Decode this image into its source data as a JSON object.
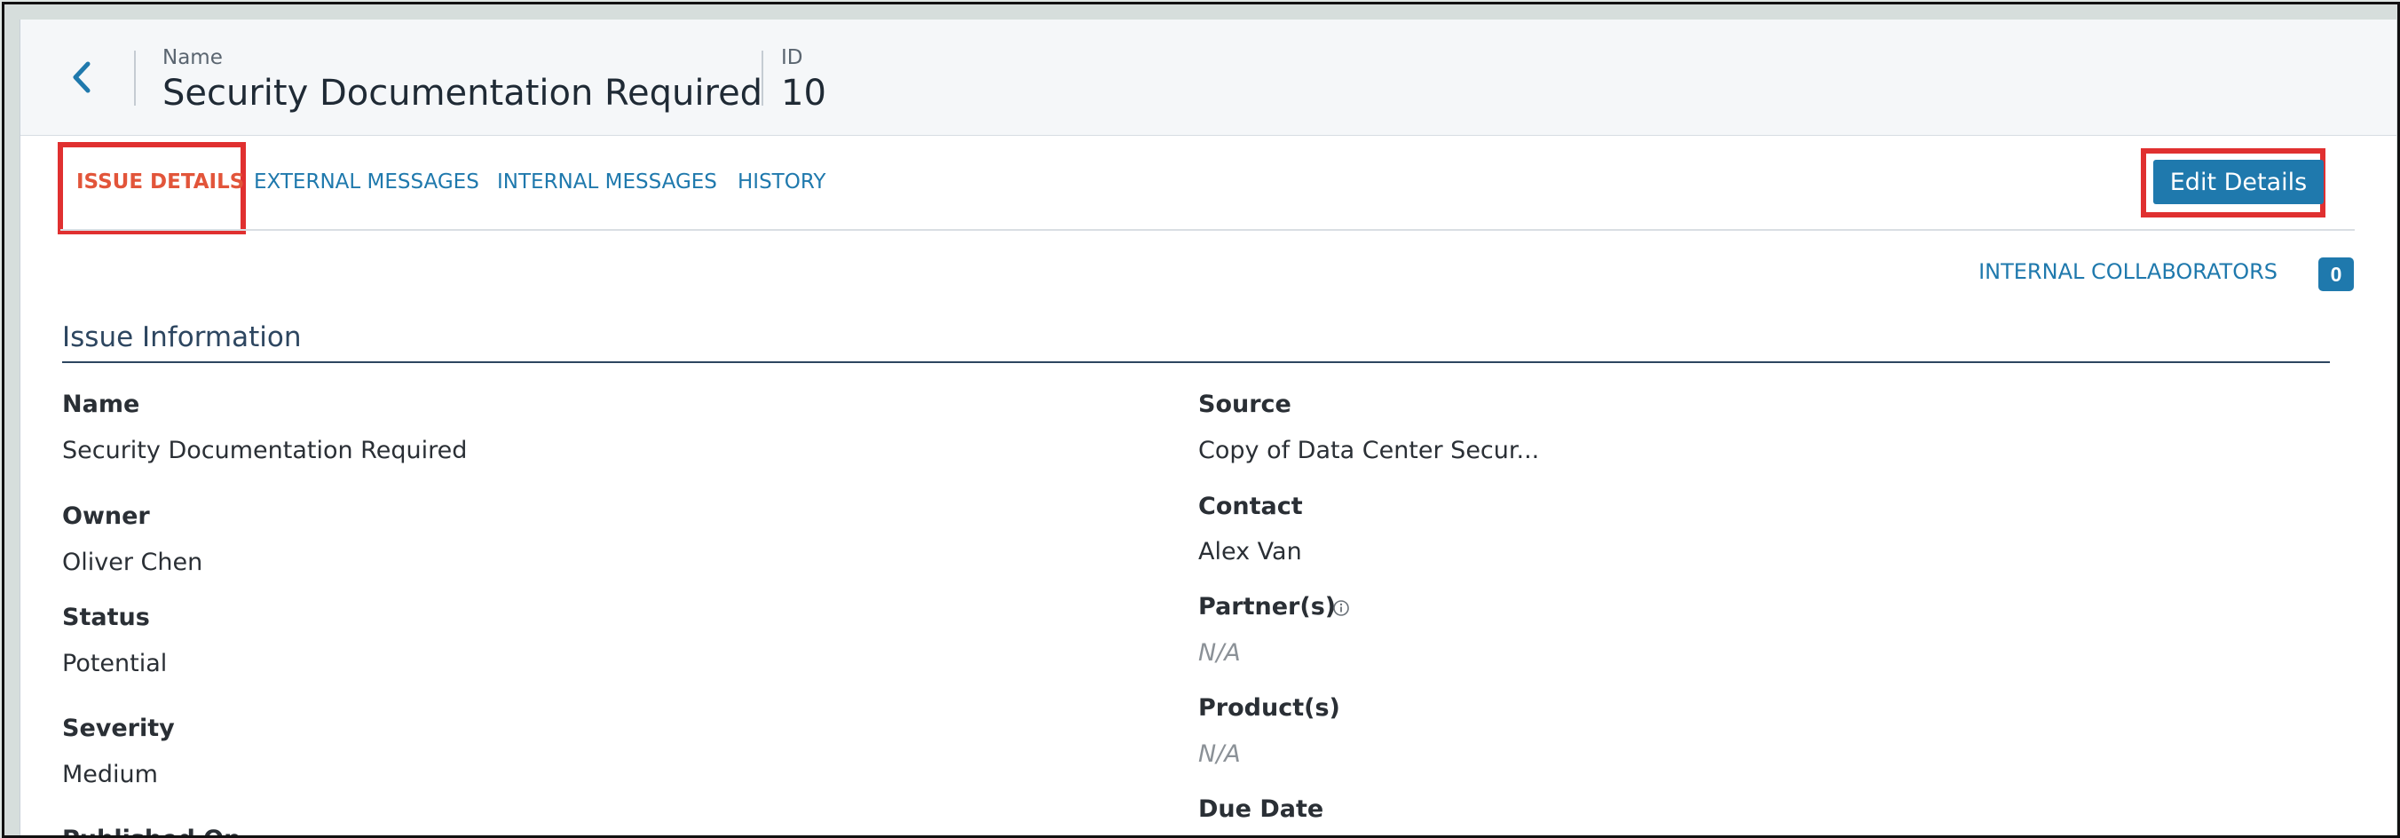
{
  "header": {
    "name_label": "Name",
    "name_value": "Security Documentation Required",
    "id_label": "ID",
    "id_value": "10"
  },
  "tabs": [
    {
      "label": "ISSUE DETAILS",
      "active": true
    },
    {
      "label": "EXTERNAL MESSAGES",
      "active": false
    },
    {
      "label": "INTERNAL MESSAGES",
      "active": false
    },
    {
      "label": "HISTORY",
      "active": false
    }
  ],
  "actions": {
    "edit_label": "Edit Details"
  },
  "collaborators": {
    "label": "INTERNAL COLLABORATORS",
    "count": "0"
  },
  "section": {
    "title": "Issue Information"
  },
  "left_fields": [
    {
      "label": "Name",
      "value": "Security Documentation Required"
    },
    {
      "label": "Owner",
      "value": "Oliver Chen"
    },
    {
      "label": "Status",
      "value": "Potential"
    },
    {
      "label": "Severity",
      "value": "Medium"
    },
    {
      "label": "Published On"
    }
  ],
  "right_fields": [
    {
      "label": "Source",
      "value": "Copy of Data Center Secur..."
    },
    {
      "label": "Contact",
      "value": "Alex Van"
    },
    {
      "label": "Partner(s)",
      "value": "N/A"
    },
    {
      "label": "Product(s)",
      "value": "N/A"
    },
    {
      "label": "Due Date"
    }
  ],
  "colors": {
    "accent": "#1f79ad",
    "active_tab": "#e2553a",
    "highlight": "#e03030",
    "heading": "#2d4660"
  },
  "icons": {
    "back": "chevron-left-icon",
    "partner_info": "info-icon"
  }
}
